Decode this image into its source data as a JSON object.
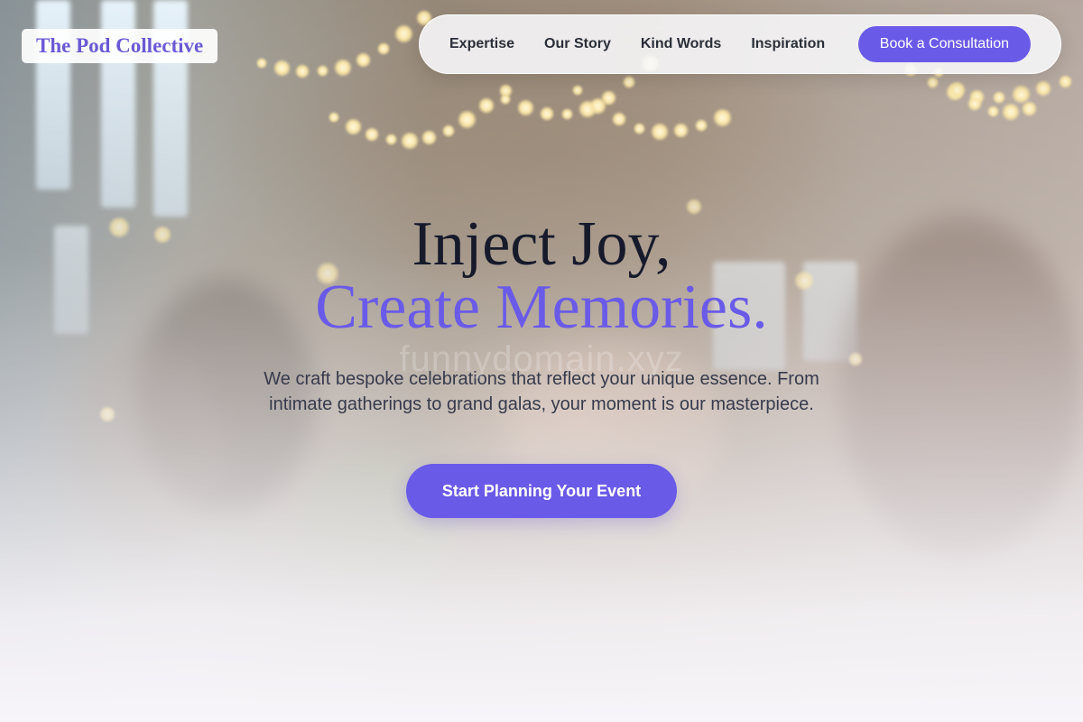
{
  "brand": {
    "name": "The Pod Collective"
  },
  "nav": {
    "links": [
      "Expertise",
      "Our Story",
      "Kind Words",
      "Inspiration"
    ],
    "cta": "Book a Consultation"
  },
  "hero": {
    "headline_line1": "Inject Joy,",
    "headline_line2": "Create Memories.",
    "watermark": "funnydomain.xyz",
    "subtext": "We craft bespoke celebrations that reflect your unique essence. From intimate gatherings to grand galas, your moment is our masterpiece.",
    "cta": "Start Planning Your Event"
  },
  "colors": {
    "accent": "#6a5ae8",
    "headline_dark": "#161a2b",
    "body_text": "#363b4c"
  }
}
